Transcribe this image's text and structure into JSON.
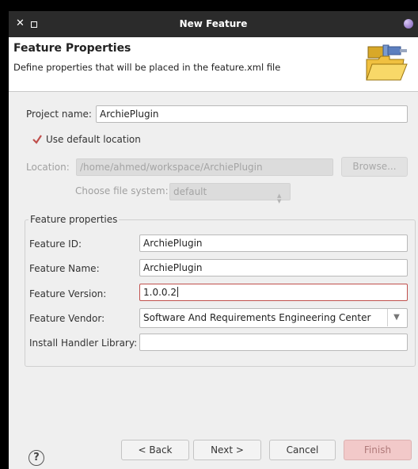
{
  "window": {
    "title": "New Feature"
  },
  "header": {
    "title": "Feature Properties",
    "description": "Define properties that will be placed in the feature.xml file"
  },
  "project": {
    "name_label": "Project name:",
    "name_value": "ArchiePlugin",
    "use_default_label": "Use default location",
    "use_default_checked": true,
    "location_label": "Location:",
    "location_value": "/home/ahmed/workspace/ArchiePlugin",
    "browse_label": "Browse...",
    "filesystem_label": "Choose file system:",
    "filesystem_value": "default"
  },
  "feature": {
    "group_title": "Feature properties",
    "id_label": "Feature ID:",
    "id_value": "ArchiePlugin",
    "name_label": "Feature Name:",
    "name_value": "ArchiePlugin",
    "version_label": "Feature Version:",
    "version_value": "1.0.0.2",
    "vendor_label": "Feature Vendor:",
    "vendor_value": "Software And Requirements Engineering Center",
    "install_label": "Install Handler Library:",
    "install_value": ""
  },
  "footer": {
    "back_label": "< Back",
    "next_label": "Next >",
    "cancel_label": "Cancel",
    "finish_label": "Finish"
  },
  "colors": {
    "titlebar": "#2b2b2b",
    "accent": "#c0504d",
    "finish_bg": "#f2c9c9"
  },
  "icons": [
    "close-icon",
    "maximize-icon",
    "app-ball-icon",
    "folder-banner-icon",
    "checkmark-icon",
    "chevron-down-icon",
    "help-icon"
  ]
}
